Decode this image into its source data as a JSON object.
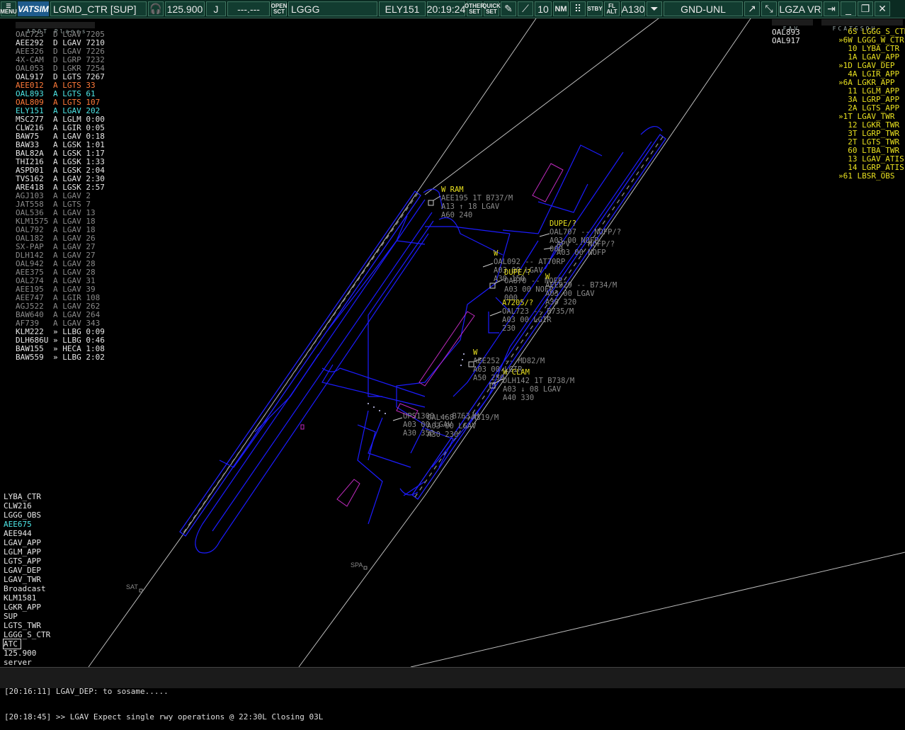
{
  "toolbar": {
    "menu_label": "MENU",
    "logo": "VATSIM",
    "callsign": "LGMD_CTR [SUP]",
    "frequency": "125.900",
    "atis_letter": "J",
    "secondary_freq": "---.---",
    "open_label": "OPEN",
    "sct_label": "SCT",
    "sector_file": "LGGG",
    "selected_aircraft": "ELY151",
    "time": "20:19:24",
    "other_label": "OTHER",
    "set_label": "SET",
    "quick_label": "QUICK",
    "quick_set_label": "SET",
    "range": "10",
    "range_unit": "NM",
    "stby_label": "STBY",
    "fl_label": "FL",
    "alt_label": "ALT",
    "transition_alt": "A130",
    "fl_filter_label": "FL",
    "altitude_filter": "GND-UNL",
    "view_name": "LGZA VR"
  },
  "colors": {
    "toolbar_bg": "#0b2b22",
    "runway": "#1c1cff",
    "default_text": "#e6e6e6",
    "grey_text": "#8a8a8a",
    "yellow": "#e8e020",
    "cyan": "#4ee6e6",
    "orange": "#ff7a3a"
  },
  "left_list": {
    "header": "ADOT Planes",
    "rows": [
      {
        "text": "OAL723  D LGAV 7205",
        "color": "grey"
      },
      {
        "text": "AEE292  D LGAV 7210",
        "color": "white"
      },
      {
        "text": "AEE326  D LGAV 7226",
        "color": "grey"
      },
      {
        "text": "4X-CAM  D LGRP 7232",
        "color": "grey"
      },
      {
        "text": "OAL053  D LGKR 7254",
        "color": "grey"
      },
      {
        "text": "OAL917  D LGTS 7267",
        "color": "white"
      },
      {
        "text": "AEE012  A LGTS 33",
        "color": "orange"
      },
      {
        "text": "OAL893  A LGTS 61",
        "color": "cyan"
      },
      {
        "text": "OAL809  A LGTS 107",
        "color": "orange"
      },
      {
        "text": "ELY151  A LGAV 202",
        "color": "cyan"
      },
      {
        "text": "MSC277  A LGLM 0:00",
        "color": "white"
      },
      {
        "text": "CLW216  A LGIR 0:05",
        "color": "white"
      },
      {
        "text": "BAW75   A LGAV 0:18",
        "color": "white"
      },
      {
        "text": "BAW33   A LGSK 1:01",
        "color": "white"
      },
      {
        "text": "BAL82A  A LGSK 1:17",
        "color": "white"
      },
      {
        "text": "THI216  A LGSK 1:33",
        "color": "white"
      },
      {
        "text": "ASPD01  A LGSK 2:04",
        "color": "white"
      },
      {
        "text": "TVS162  A LGAV 2:30",
        "color": "white"
      },
      {
        "text": "ARE418  A LGSK 2:57",
        "color": "white"
      },
      {
        "text": "AGJ103  A LGAV 2",
        "color": "grey"
      },
      {
        "text": "JAT558  A LGTS 7",
        "color": "grey"
      },
      {
        "text": "OAL536  A LGAV 13",
        "color": "grey"
      },
      {
        "text": "KLM1575 A LGAV 18",
        "color": "grey"
      },
      {
        "text": "OAL792  A LGAV 18",
        "color": "grey"
      },
      {
        "text": "OAL182  A LGAV 26",
        "color": "grey"
      },
      {
        "text": "SX-PAP  A LGAV 27",
        "color": "grey"
      },
      {
        "text": "DLH142  A LGAV 27",
        "color": "grey"
      },
      {
        "text": "OAL942  A LGAV 28",
        "color": "grey"
      },
      {
        "text": "AEE375  A LGAV 28",
        "color": "grey"
      },
      {
        "text": "OAL274  A LGAV 31",
        "color": "grey"
      },
      {
        "text": "AEE195  A LGAV 39",
        "color": "grey"
      },
      {
        "text": "AEE747  A LGIR 108",
        "color": "grey"
      },
      {
        "text": "AGJ522  A LGAV 262",
        "color": "grey"
      },
      {
        "text": "BAW640  A LGAV 264",
        "color": "grey"
      },
      {
        "text": "AF739   A LGAV 343",
        "color": "grey"
      },
      {
        "text": "KLM222  » LLBG 0:09",
        "color": "white"
      },
      {
        "text": "DLH686U » LLBG 0:46",
        "color": "white"
      },
      {
        "text": "BAW155  » HECA 1:08",
        "color": "white"
      },
      {
        "text": "BAW559  » LLBG 2:02",
        "color": "white"
      }
    ]
  },
  "mid_right_list": {
    "header": "FAV",
    "rows": [
      "OAL893",
      "OAL917"
    ]
  },
  "controller_list": {
    "header": "FCATGSOU",
    "rows": [
      "  6S LGGG_S_CTR",
      "»6W LGGG_W_CTR",
      "  10 LYBA_CTR",
      "  1A LGAV_APP",
      "»1D LGAV_DEP",
      "  4A LGIR_APP",
      "»6A LGKR_APP",
      "  11 LGLM_APP",
      "  3A LGRP_APP",
      "  2A LGTS_APP",
      "»1T LGAV_TWR",
      "  12 LGKR_TWR",
      "  3T LGRP_TWR",
      "  2T LGTS_TWR",
      "  60 LTBA_TWR",
      "  13 LGAV_ATIS",
      "  14 LGRP_ATIS",
      "»61 LBSR_OBS"
    ]
  },
  "chat_tabs": [
    {
      "text": "LYBA_CTR",
      "color": "white"
    },
    {
      "text": "CLW216",
      "color": "white"
    },
    {
      "text": "LGGG_OBS",
      "color": "white"
    },
    {
      "text": "AEE675",
      "color": "cyan"
    },
    {
      "text": "AEE944",
      "color": "white"
    },
    {
      "text": "LGAV_APP",
      "color": "white"
    },
    {
      "text": "LGLM_APP",
      "color": "white"
    },
    {
      "text": "LGTS_APP",
      "color": "white"
    },
    {
      "text": "LGAV_DEP",
      "color": "white"
    },
    {
      "text": "LGAV_TWR",
      "color": "white"
    },
    {
      "text": "Broadcast",
      "color": "white"
    },
    {
      "text": "KLM1581",
      "color": "white"
    },
    {
      "text": "LGKR_APP",
      "color": "white"
    },
    {
      "text": "SUP",
      "color": "white"
    },
    {
      "text": "LGTS_TWR",
      "color": "white"
    },
    {
      "text": "LGGG_S_CTR",
      "color": "white"
    },
    {
      "text": "ATC",
      "color": "white"
    },
    {
      "text": "125.900",
      "color": "white"
    },
    {
      "text": "server",
      "color": "white"
    }
  ],
  "messages": [
    "[20:16:11] LGAV_DEP: to sosame.....",
    "[20:18:45] >> LGAV Expect single rwy operations @ 22:30L Closing 03L"
  ],
  "map_fixes": [
    "SAT",
    "SPA"
  ],
  "aircraft_labels": [
    {
      "lines": [
        "W RAM",
        "AEE195 1T B737/M",
        "A13 ↑ 18 LGAV",
        "A60 240"
      ],
      "colors": [
        "yellow",
        "grey",
        "grey",
        "grey"
      ]
    },
    {
      "lines": [
        "DUPE/?",
        "OAL707 -- NOFP/?",
        "A03 00 NOFP",
        "000"
      ],
      "colors": [
        "yellow",
        "grey",
        "grey",
        "grey"
      ]
    },
    {
      "lines": [
        "APV -- NOFP/?",
        "A03 00 NOFP"
      ],
      "colors": [
        "grey",
        "grey"
      ]
    },
    {
      "lines": [
        "W",
        "OAL092 -- AT70RP",
        "A03 00 LGAV",
        "A30 150"
      ],
      "colors": [
        "yellow",
        "grey",
        "grey",
        "grey"
      ]
    },
    {
      "lines": [
        "DUPE/?",
        "OA870 -- NOFP",
        "A03 00 NOFP",
        "000"
      ],
      "colors": [
        "yellow",
        "grey",
        "grey",
        "grey"
      ]
    },
    {
      "lines": [
        "W",
        "AEE929 -- B734/M",
        "A03 00 LGAV",
        "A30 320"
      ],
      "colors": [
        "yellow",
        "grey",
        "grey",
        "grey"
      ]
    },
    {
      "lines": [
        "A7205/?",
        "OAL723 -- B735/M",
        "A03 00 LGIR",
        "230"
      ],
      "colors": [
        "yellow",
        "grey",
        "grey",
        "grey"
      ]
    },
    {
      "lines": [
        "W",
        "AEE252 -- MD82/M",
        "A03 00 LGIR",
        "A50 250"
      ],
      "colors": [
        "yellow",
        "grey",
        "grey",
        "grey"
      ]
    },
    {
      "lines": [
        "W CLAM",
        "DLH142 1T B738/M",
        "A03 ↓ 08 LGAV",
        "A40 330"
      ],
      "colors": [
        "yellow",
        "grey",
        "grey",
        "grey"
      ]
    },
    {
      "lines": [
        "UPS1300 -- B763/H",
        "A03 00 LGAV",
        "A30 350"
      ],
      "colors": [
        "grey",
        "grey",
        "grey"
      ]
    },
    {
      "lines": [
        "OAL468 -- A319/M",
        "A03 00 LGAV",
        "A30 230"
      ],
      "colors": [
        "grey",
        "grey",
        "grey"
      ]
    }
  ]
}
